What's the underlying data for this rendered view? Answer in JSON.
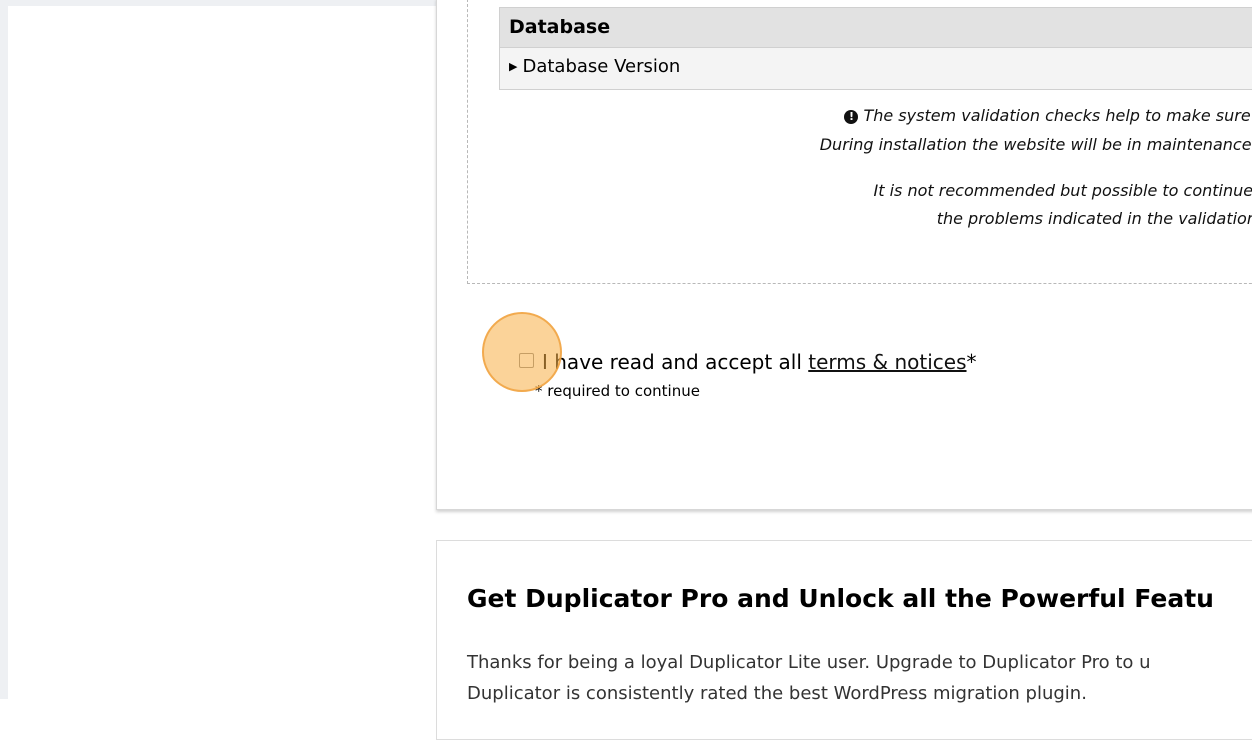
{
  "database": {
    "header": "Database",
    "row": "Database Version"
  },
  "validation_note": {
    "line1": "The system validation checks help to make sure the",
    "line2": "During installation the website will be in maintenance mo",
    "line3": "It is not recommended but possible to continue wit",
    "line4": "the problems indicated in the validation ha"
  },
  "accept": {
    "text": "I have read and accept all",
    "link": "terms & notices",
    "asterisk": "*",
    "required": "* required to continue"
  },
  "promo": {
    "title": "Get Duplicator Pro and Unlock all the Powerful Featu",
    "line1": "Thanks for being a loyal Duplicator Lite user. Upgrade to Duplicator Pro to u",
    "line2": "Duplicator is consistently rated the best WordPress migration plugin."
  },
  "icons": {
    "info": "info-circle-icon",
    "expand": "caret-right-icon"
  },
  "colors": {
    "click_marker": "#f7af46",
    "header_bg": "#e2e2e2"
  }
}
